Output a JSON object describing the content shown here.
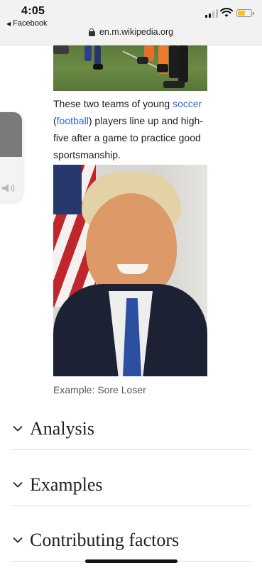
{
  "status_bar": {
    "time": "4:05",
    "back_app": "Facebook",
    "battery_color": "#f0c419"
  },
  "browser": {
    "url": "en.m.wikipedia.org"
  },
  "article": {
    "soccer_caption": {
      "before": "These two teams of young ",
      "link1": "soccer",
      "between": " (",
      "link2": "football",
      "after": ") players line up and high-five after a game to practice good sportsmanship."
    },
    "portrait_caption": "Example: Sore Loser",
    "sections": [
      {
        "title": "Analysis",
        "icon": "chevron-down-icon"
      },
      {
        "title": "Examples",
        "icon": "chevron-down-icon"
      },
      {
        "title": "Contributing factors",
        "icon": "chevron-down-icon"
      }
    ]
  },
  "volume": {
    "level": 0.5,
    "icon": "speaker-icon"
  },
  "colors": {
    "link": "#3366cc",
    "text": "#202122",
    "caption_muted": "#54595d"
  }
}
